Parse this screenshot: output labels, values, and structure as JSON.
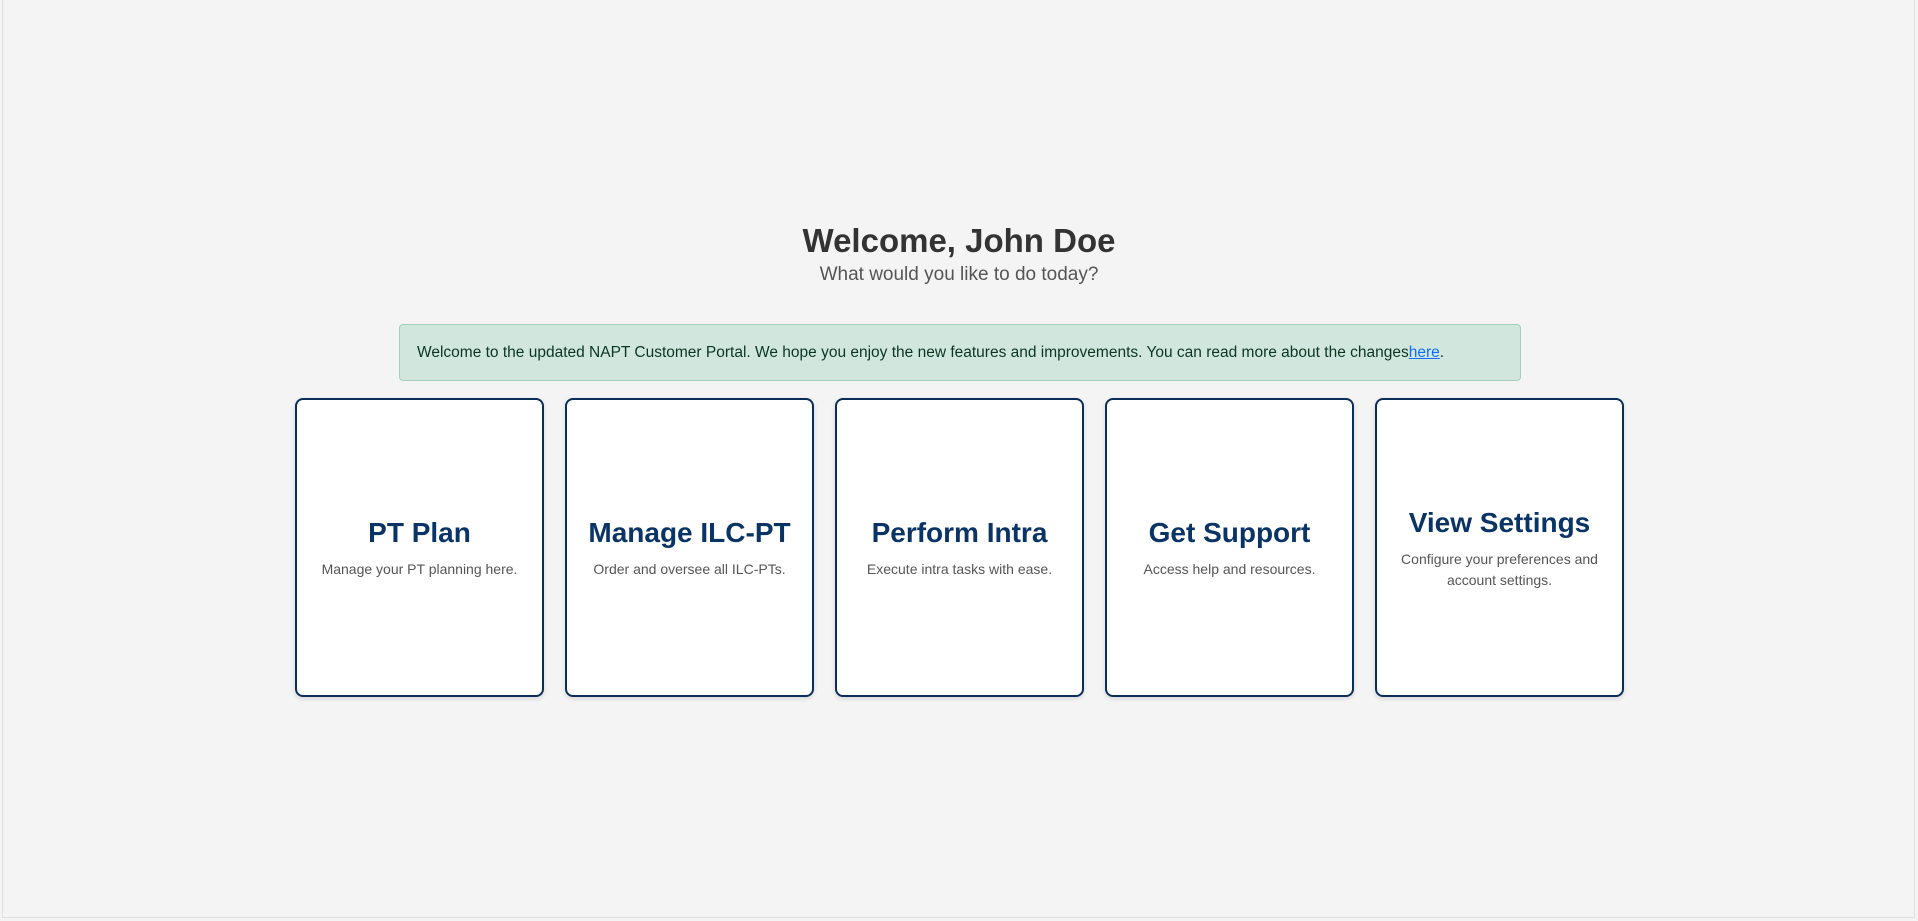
{
  "header": {
    "title": "Welcome, John Doe",
    "subtitle": "What would you like to do today?"
  },
  "notice": {
    "text": "Welcome to the updated NAPT Customer Portal. We hope you enjoy the new features and improvements. You can read more about the changes ",
    "link_label": "here",
    "suffix": "."
  },
  "cards": [
    {
      "title": "PT Plan",
      "description": "Manage your PT planning here."
    },
    {
      "title": "Manage ILC-PT",
      "description": "Order and oversee all ILC-PTs."
    },
    {
      "title": "Perform Intra",
      "description": "Execute intra tasks with ease."
    },
    {
      "title": "Get Support",
      "description": "Access help and resources."
    },
    {
      "title": "View Settings",
      "description": "Configure your preferences and account settings."
    }
  ],
  "colors": {
    "background": "#f4f4f4",
    "card_border": "#0b2e59",
    "card_title": "#0b3466",
    "notice_background": "#d1e7dd",
    "link": "#0d6efd"
  }
}
